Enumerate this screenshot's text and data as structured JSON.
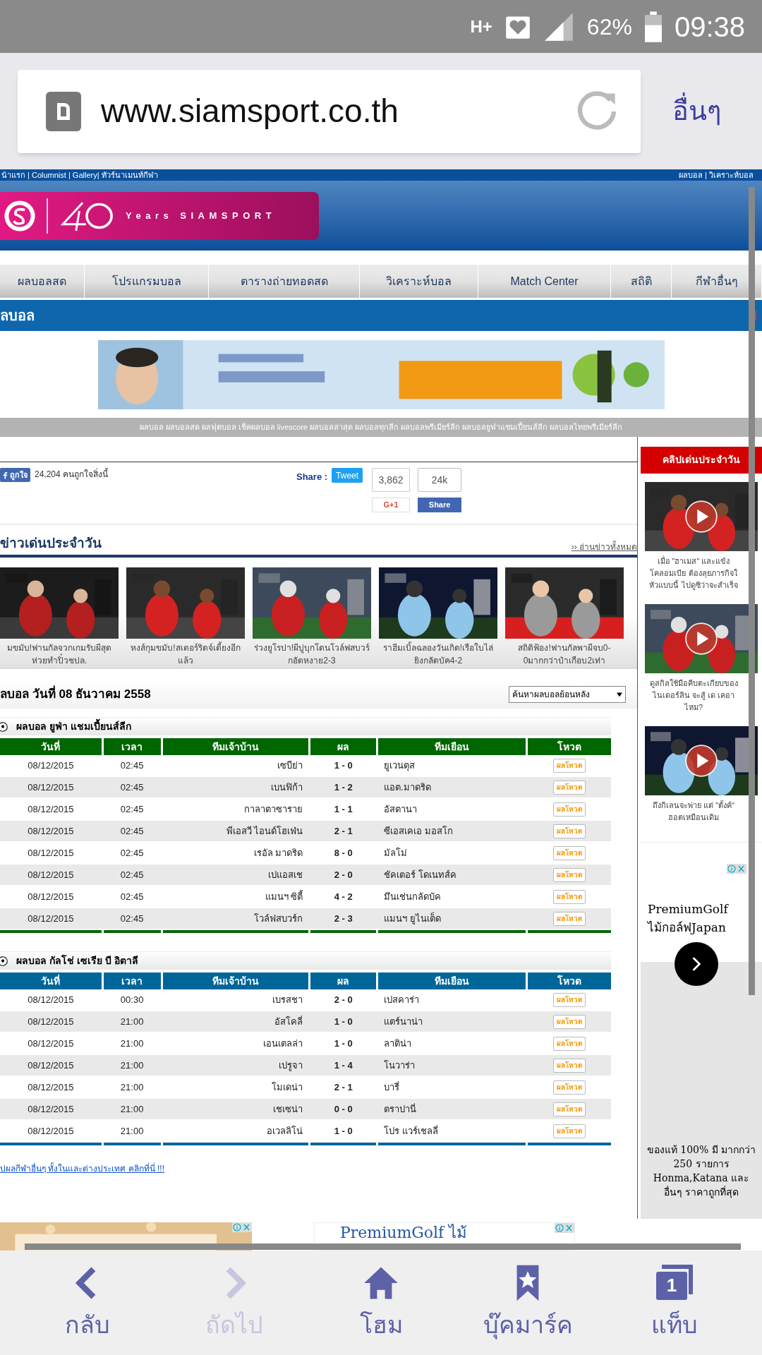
{
  "status_bar": {
    "network": "H+",
    "battery": "62%",
    "time": "09:38"
  },
  "address_bar": {
    "url": "www.siamsport.co.th",
    "menu": "อื่นๆ"
  },
  "site_header": {
    "top_links_left": "น้าแรก | Columnist | Gallery| ทัวร์นาเมนท์กีฬา",
    "top_links_right": "ผลบอล | วิเคราะห์บอล",
    "logo_text": "Years SIAMSPORT"
  },
  "nav": [
    {
      "label": "ผลบอลสด"
    },
    {
      "label": "โปรแกรมบอล"
    },
    {
      "label": "ตารางถ่ายทอดสด"
    },
    {
      "label": "วิเคราะห์บอล"
    },
    {
      "label": "Match Center"
    },
    {
      "label": "สถิติ"
    },
    {
      "label": "กีฬาอื่นๆ"
    }
  ],
  "page_title": "ลบอล",
  "keywords": "ผลบอล ผลบอลสด ผลฟุตบอล เช็คผลบอล livescore ผลบอลล่าสุด ผลบอลทุกลีก ผลบอลพรีเมียร์ลีก ผลบอลยูฟ่าแชมเปี้ยนส์ลีก ผลบอลไทยพรีเมียร์ลีก",
  "share": {
    "like_button": "ถูกใจ",
    "like_count": "24,204 คนถูกใจสิ่งนี้",
    "label": "Share :",
    "tweet": "Tweet",
    "gplus_count": "3,862",
    "gplus": "G+1",
    "fb_count": "24k",
    "fb_share": "Share"
  },
  "news": {
    "title": "ข่าวเด่นประจำวัน",
    "more": "›› อ่านข่าวทั้งหมด",
    "items": [
      {
        "caption": "มขมับ!ฟานกัลจวกเกมรับผีสุดห่วยทำปิ๋วชปล."
      },
      {
        "caption": "หงส์กุมขมับ!สเตอร์ริดจ์เดี้ยงอีกแล้ว"
      },
      {
        "caption": "ร่วงยูโรปา!ผีบู่บุกโดนโวล์ฟสบวร์กอัดหงาย2-3"
      },
      {
        "caption": "ราฮีมเบิ้ลฉลองวันเกิด!เรือใบไล่ยิงกลัดบัค4-2"
      },
      {
        "caption": "สถิติฟ้อง!ฟานกัลพาผีจบ0-0มากกว่าป๋าเกือบ2เท่า"
      }
    ]
  },
  "results": {
    "title": "ลบอล วันที่ 08 ธันวาคม 2558",
    "search_select": "ค้นหาผลบอลย้อนหลัง",
    "tables": [
      {
        "title": "ผลบอล ยูฟ่า แชมเปี้ยนส์ลีก",
        "color": "#006600",
        "columns": [
          "วันที่",
          "เวลา",
          "ทีมเจ้าบ้าน",
          "ผล",
          "ทีมเยือน",
          "โหวต"
        ],
        "rows": [
          [
            "08/12/2015",
            "02:45",
            "เซบีย่า",
            "1 - 0",
            "ยูเวนตุส",
            "ผลโหวต"
          ],
          [
            "08/12/2015",
            "02:45",
            "เบนฟิก้า",
            "1 - 2",
            "แอต.มาดริด",
            "ผลโหวต"
          ],
          [
            "08/12/2015",
            "02:45",
            "กาลาตาซาราย",
            "1 - 1",
            "อัสตานา",
            "ผลโหวต"
          ],
          [
            "08/12/2015",
            "02:45",
            "พีเอสวี ไอนด์โฮเฟ่น",
            "2 - 1",
            "ซีเอสเคเอ มอสโก",
            "ผลโหวต"
          ],
          [
            "08/12/2015",
            "02:45",
            "เรอัล มาดริด",
            "8 - 0",
            "มัลโม่",
            "ผลโหวต"
          ],
          [
            "08/12/2015",
            "02:45",
            "เปแอสเช",
            "2 - 0",
            "ชัคเตอร์ โดเนทส์ค",
            "ผลโหวต"
          ],
          [
            "08/12/2015",
            "02:45",
            "แมนฯ ซิตี้",
            "4 - 2",
            "มึนเช่นกลัดบัค",
            "ผลโหวต"
          ],
          [
            "08/12/2015",
            "02:45",
            "โวล์ฟสบวร์ก",
            "2 - 3",
            "แมนฯ ยูไนเต็ด",
            "ผลโหวต"
          ]
        ]
      },
      {
        "title": "ผลบอล กัลโช่ เซเรีย บี อิตาลี",
        "color": "#00669a",
        "columns": [
          "วันที่",
          "เวลา",
          "ทีมเจ้าบ้าน",
          "ผล",
          "ทีมเยือน",
          "โหวต"
        ],
        "rows": [
          [
            "08/12/2015",
            "00:30",
            "เบรสชา",
            "2 - 0",
            "เปสคาร่า",
            "ผลโหวต"
          ],
          [
            "08/12/2015",
            "21:00",
            "อัสโคลี่",
            "1 - 0",
            "แตร์นาน่า",
            "ผลโหวต"
          ],
          [
            "08/12/2015",
            "21:00",
            "เอนเตลล่า",
            "1 - 0",
            "ลาติน่า",
            "ผลโหวต"
          ],
          [
            "08/12/2015",
            "21:00",
            "เปรูจา",
            "1 - 4",
            "โนวาร่า",
            "ผลโหวต"
          ],
          [
            "08/12/2015",
            "21:00",
            "โมเดน่า",
            "2 - 1",
            "บารี่",
            "ผลโหวต"
          ],
          [
            "08/12/2015",
            "21:00",
            "เชเซน่า",
            "0 - 0",
            "ตราปานี่",
            "ผลโหวต"
          ],
          [
            "08/12/2015",
            "21:00",
            "อเวลลิโน่",
            "1 - 0",
            "โปร แวร์เชลลี่",
            "ผลโหวต"
          ]
        ]
      }
    ],
    "more_link": "ปผลกีฬาอื่นๆ ทั้งในและต่างประเทศ คลิกที่นี่ !!!"
  },
  "bottom_ads": {
    "right_text": "PremiumGolf ไม้"
  },
  "sidebar": {
    "title": "คลิปเด่นประจำวัน",
    "clips": [
      {
        "caption": [
          "เมื่อ \"ฮาเมส\" และแข้ง",
          "โคลอมเบีย ต้องลุยภารกิจใ",
          "หัวแบบนี้ ไปดูซิว่าจะสำเร็จ"
        ]
      },
      {
        "caption": [
          "ดูสกิลใช้มือคีบตะเกียบของ",
          "ไนเดอร์ลิน จะสู้ เด เคอา",
          "ไหม?"
        ]
      },
      {
        "caption": [
          "ถึงกิเลนจะพ่าย แต่ \"ตั้งค์\"",
          "ฮอตเหมือนเดิม"
        ]
      }
    ],
    "ad": {
      "title": "PremiumGolf",
      "subtitle": "ไม้กอล์ฟJapan",
      "body": "ของแท้ 100% มี มากกว่า 250 รายการ Honma,Katana และ อื่นๆ ราคาถูกที่สุด"
    }
  },
  "bottom_nav": [
    {
      "label": "กลับ",
      "kind": "back",
      "disabled": false
    },
    {
      "label": "ถัดไป",
      "kind": "forward",
      "disabled": true
    },
    {
      "label": "โฮม",
      "kind": "home",
      "disabled": false
    },
    {
      "label": "บุ๊คมาร์ค",
      "kind": "bookmark",
      "disabled": false
    },
    {
      "label": "แท็บ",
      "kind": "tabs",
      "disabled": false,
      "count": "1"
    }
  ]
}
